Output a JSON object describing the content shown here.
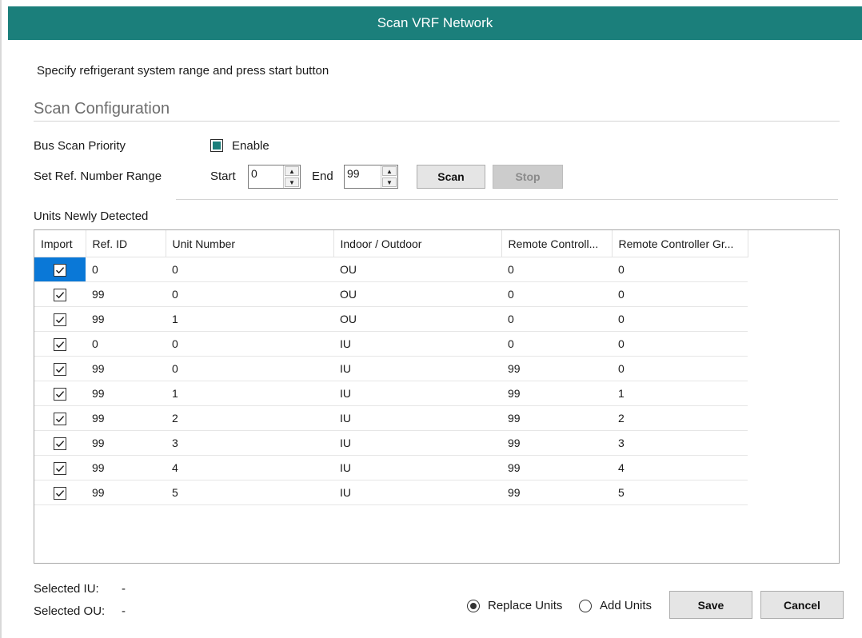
{
  "window": {
    "title": "Scan VRF Network"
  },
  "instructions": "Specify refrigerant system range and press start button",
  "scan_config": {
    "section_title": "Scan Configuration",
    "bus_scan_label": "Bus Scan Priority",
    "enable_label": "Enable",
    "enable_checked": true,
    "range_label": "Set Ref. Number Range",
    "start_label": "Start",
    "start_value": "0",
    "end_label": "End",
    "end_value": "99",
    "scan_button": "Scan",
    "stop_button": "Stop"
  },
  "units": {
    "label": "Units Newly Detected",
    "columns": [
      "Import",
      "Ref. ID",
      "Unit Number",
      "Indoor / Outdoor",
      "Remote Controll...",
      "Remote Controller Gr..."
    ],
    "rows": [
      {
        "import": true,
        "ref_id": "0",
        "unit_number": "0",
        "io": "OU",
        "rc": "0",
        "rcg": "0"
      },
      {
        "import": true,
        "ref_id": "99",
        "unit_number": "0",
        "io": "OU",
        "rc": "0",
        "rcg": "0"
      },
      {
        "import": true,
        "ref_id": "99",
        "unit_number": "1",
        "io": "OU",
        "rc": "0",
        "rcg": "0"
      },
      {
        "import": true,
        "ref_id": "0",
        "unit_number": "0",
        "io": "IU",
        "rc": "0",
        "rcg": "0"
      },
      {
        "import": true,
        "ref_id": "99",
        "unit_number": "0",
        "io": "IU",
        "rc": "99",
        "rcg": "0"
      },
      {
        "import": true,
        "ref_id": "99",
        "unit_number": "1",
        "io": "IU",
        "rc": "99",
        "rcg": "1"
      },
      {
        "import": true,
        "ref_id": "99",
        "unit_number": "2",
        "io": "IU",
        "rc": "99",
        "rcg": "2"
      },
      {
        "import": true,
        "ref_id": "99",
        "unit_number": "3",
        "io": "IU",
        "rc": "99",
        "rcg": "3"
      },
      {
        "import": true,
        "ref_id": "99",
        "unit_number": "4",
        "io": "IU",
        "rc": "99",
        "rcg": "4"
      },
      {
        "import": true,
        "ref_id": "99",
        "unit_number": "5",
        "io": "IU",
        "rc": "99",
        "rcg": "5"
      }
    ]
  },
  "footer": {
    "selected_iu_label": "Selected IU:",
    "selected_iu_value": "-",
    "selected_ou_label": "Selected OU:",
    "selected_ou_value": "-",
    "replace_label": "Replace Units",
    "add_label": "Add Units",
    "mode_selected": "replace",
    "save_button": "Save",
    "cancel_button": "Cancel"
  },
  "colors": {
    "accent": "#1b7f7b",
    "selection": "#0a78d7"
  }
}
